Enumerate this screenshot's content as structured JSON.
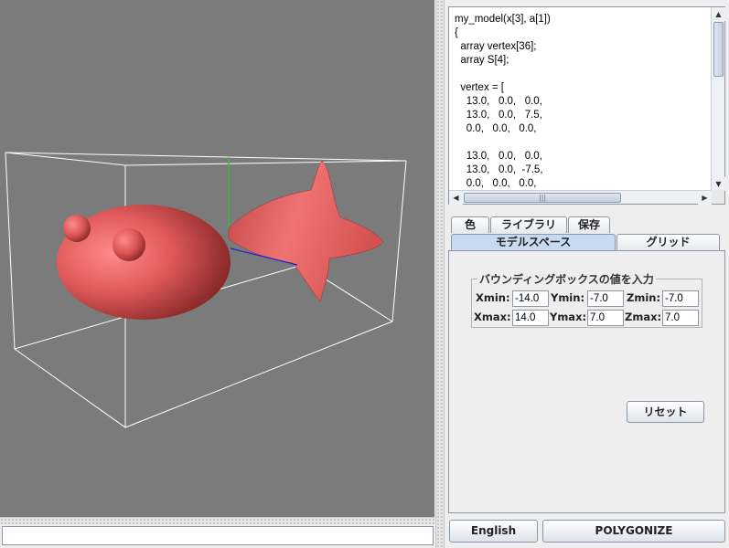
{
  "code": {
    "lines": [
      "my_model(x[3], a[1])",
      "{",
      "  array vertex[36];",
      "  array S[4];",
      "",
      "  vertex = [",
      "    13.0,   0.0,   0.0,",
      "    13.0,   0.0,   7.5,",
      "    0.0,   0.0,   0.0,",
      "",
      "    13.0,   0.0,   0.0,",
      "    13.0,   0.0,  -7.5,",
      "    0.0,   0.0,   0.0,"
    ]
  },
  "tabs_row1": [
    {
      "label": "色"
    },
    {
      "label": "ライブラリ"
    },
    {
      "label": "保存"
    }
  ],
  "tabs_row2": [
    {
      "label": "モデルスペース",
      "selected": true
    },
    {
      "label": "グリッド",
      "selected": false
    }
  ],
  "bounding_box": {
    "title": "バウンディングボックスの値を入力",
    "xmin_label": "Xmin:",
    "xmin": "-14.0",
    "ymin_label": "Ymin:",
    "ymin": "-7.0",
    "zmin_label": "Zmin:",
    "zmin": "-7.0",
    "xmax_label": "Xmax:",
    "xmax": "14.0",
    "ymax_label": "Ymax:",
    "ymax": "7.0",
    "zmax_label": "Zmax:",
    "zmax": "7.0"
  },
  "buttons": {
    "reset": "リセット",
    "language": "English",
    "polygonize": "POLYGONIZE"
  },
  "status": {
    "value": ""
  },
  "colors": {
    "viewport_bg": "#7b7b7b",
    "model": "#e05a5a",
    "axis_y": "#22cc22",
    "axis_x": "#2222cc",
    "box": "#ffffff",
    "selected_tab": "#c8daf2"
  }
}
